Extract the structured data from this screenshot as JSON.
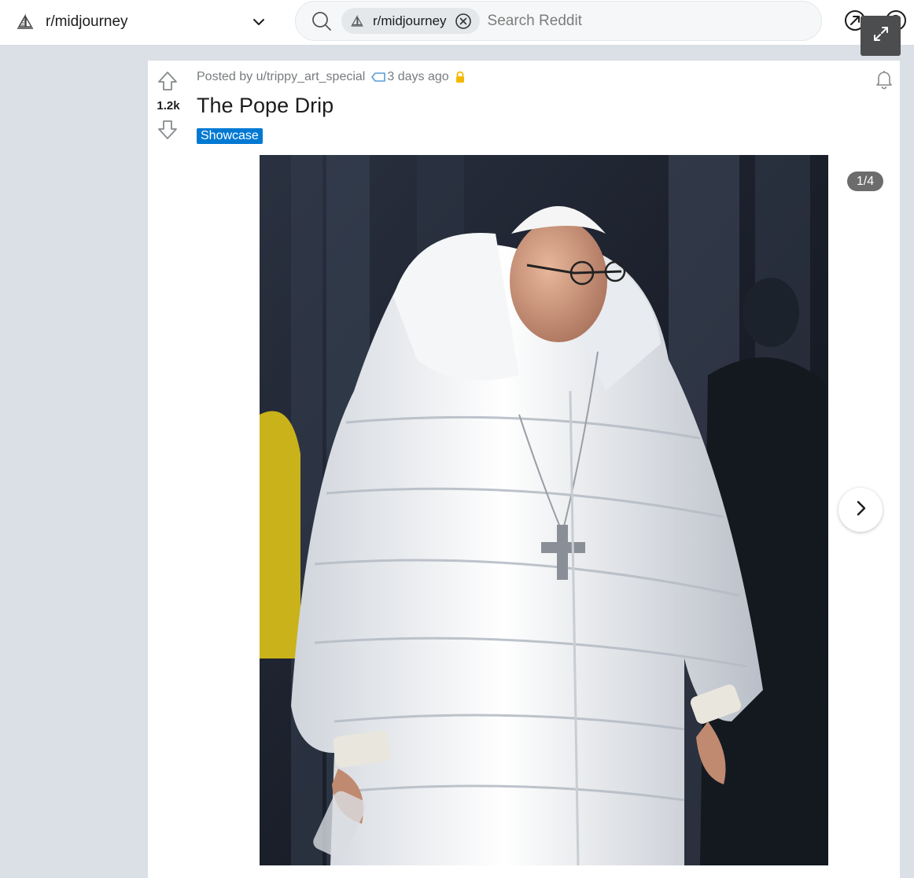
{
  "header": {
    "community_name": "r/midjourney",
    "community_icon": "sailboat-icon",
    "dropdown_icon": "chevron-down-icon"
  },
  "search": {
    "chip_label": "r/midjourney",
    "placeholder": "Search Reddit",
    "value": "",
    "icon": "search-icon"
  },
  "toolbar": {
    "popout_icon": "arrow-up-right-circle-icon",
    "copyright_icon": "copyright-icon",
    "expand_icon": "expand-icon"
  },
  "post": {
    "posted_by_prefix": "Posted by",
    "author": "u/trippy_art_special",
    "age": "3 days ago",
    "score": "1.2k",
    "title": "The Pope Drip",
    "flair": "Showcase",
    "gallery_counter": "1/4"
  },
  "colors": {
    "page_background": "#dae0e6",
    "flair_background": "#0079d3",
    "lock_icon": "#f5b800",
    "tag_icon": "#5a9bd5"
  }
}
